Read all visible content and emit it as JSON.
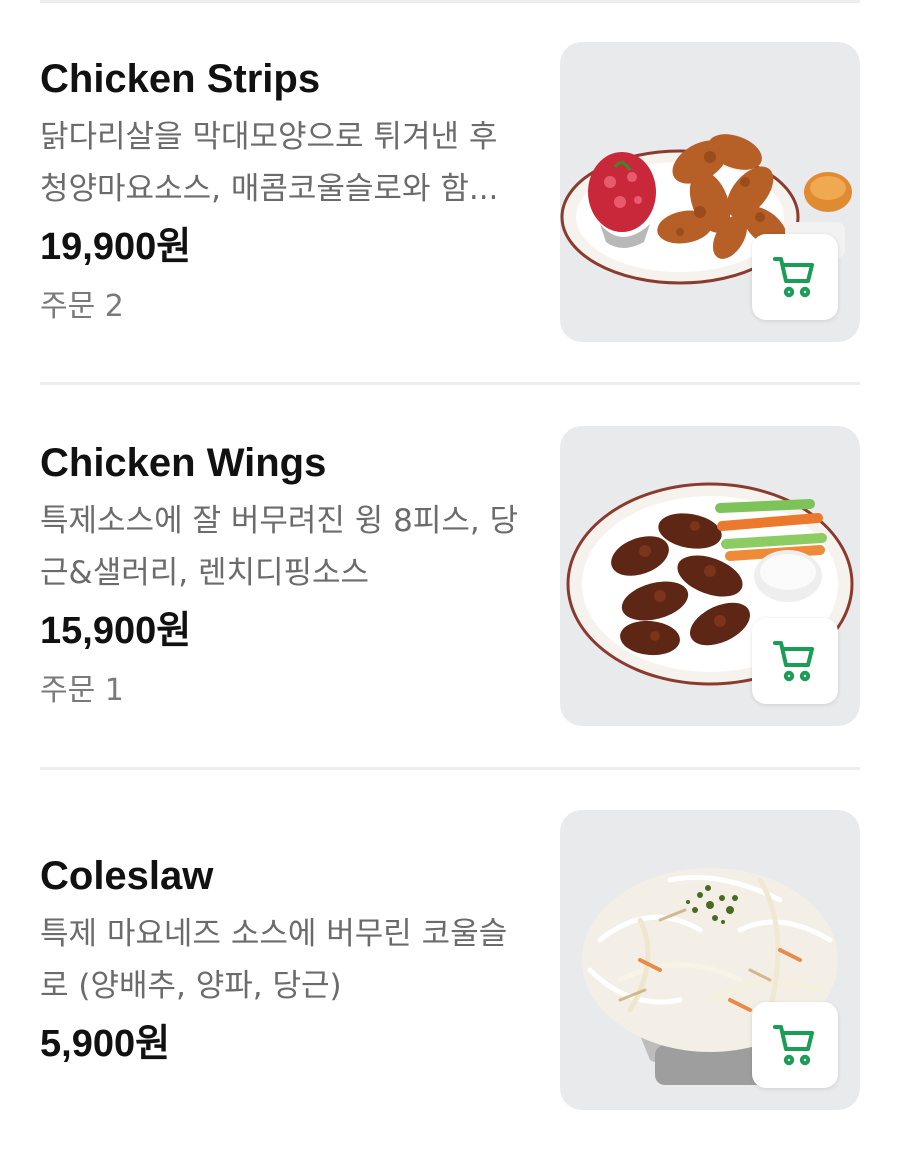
{
  "menu": {
    "items": [
      {
        "name": "Chicken Strips",
        "description": "닭다리살을 막대모양으로 튀겨낸 후 청양마요소스, 매콤코울슬로와 함...",
        "price": "19,900원",
        "orders": "주문 2",
        "image": "chicken-strips-photo"
      },
      {
        "name": "Chicken Wings",
        "description": "특제소스에 잘 버무려진 윙 8피스, 당근&샐러리, 렌치디핑소스",
        "price": "15,900원",
        "orders": "주문 1",
        "image": "chicken-wings-photo"
      },
      {
        "name": "Coleslaw",
        "description": "특제 마요네즈 소스에 버무린 코울슬로 (양배추, 양파, 당근)",
        "price": "5,900원",
        "image": "coleslaw-photo"
      }
    ]
  },
  "colors": {
    "cart_icon": "#1a9e55",
    "divider": "#ededed",
    "description_text": "#6b6b6b"
  },
  "icons": {
    "cart": "cart-icon"
  }
}
